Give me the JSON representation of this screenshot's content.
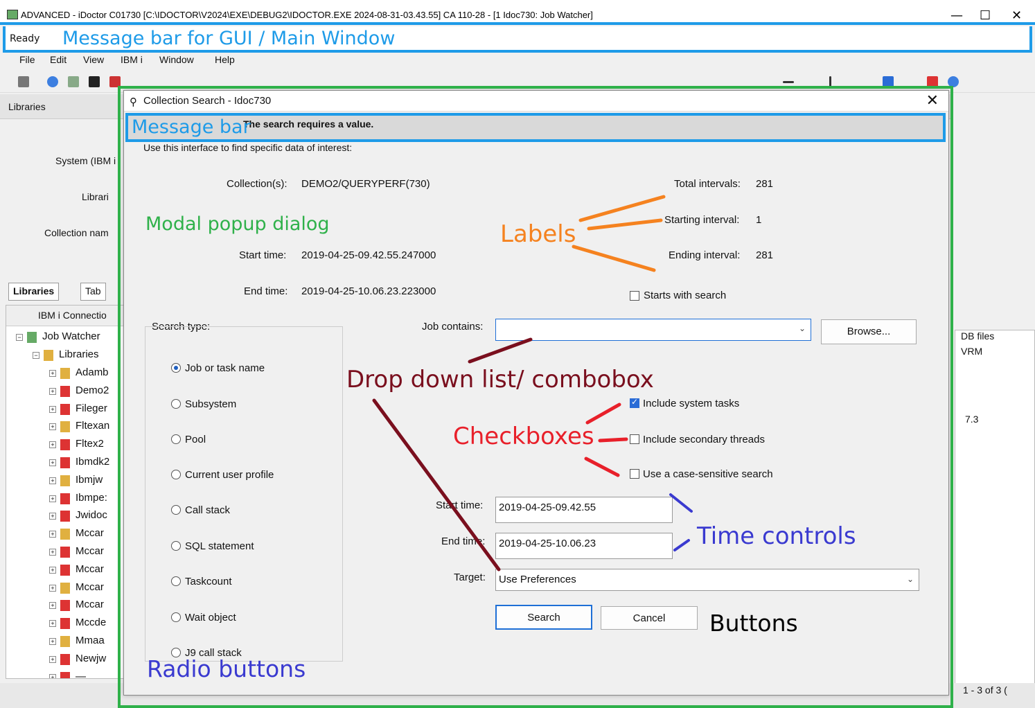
{
  "window": {
    "title": "ADVANCED - iDoctor C01730   [C:\\IDOCTOR\\V2024\\EXE\\DEBUG2\\IDOCTOR.EXE 2024-08-31-03.43.55] CA 110-28 - [1 Idoc730:  Job Watcher]",
    "status": "Ready",
    "minimize": "—",
    "maximize": "☐",
    "close": "✕"
  },
  "menu": [
    "File",
    "Edit",
    "View",
    "IBM i",
    "Window",
    "Help"
  ],
  "background": {
    "libraries_label": "Libraries",
    "system_label": "System (IBM i",
    "library_label": "Librari",
    "collection_label": "Collection nam",
    "tabs": [
      "Libraries",
      "Tab"
    ],
    "tree_header": "IBM i Connectio",
    "tree_root": "Job Watcher",
    "tree_libraries": "Libraries",
    "tree_items": [
      "Adamb",
      "Demo2",
      "Fileger",
      "Fltexan",
      "Fltex2",
      "Ibmdk2",
      "Ibmjw",
      "Ibmpe:",
      "Jwidoc",
      "Mccar",
      "Mccar",
      "Mccar",
      "Mccar",
      "Mccar",
      "Mccde",
      "Mmaa",
      "Newjw",
      "—"
    ],
    "grid_header_1": "DB files",
    "grid_header_2": "VRM",
    "grid_value": "7.3",
    "page_count": "1 - 3 of 3 ("
  },
  "dialog": {
    "title": "Collection Search - Idoc730",
    "close": "✕",
    "message": "The search requires a value.",
    "intro": "Use this interface to find specific data of interest:",
    "collection_label": "Collection(s):",
    "collection_value": "DEMO2/QUERYPERF(730)",
    "start_time_label": "Start time:",
    "start_time_value": "2019-04-25-09.42.55.247000",
    "end_time_label": "End time:",
    "end_time_value": "2019-04-25-10.06.23.223000",
    "total_intervals_label": "Total intervals:",
    "total_intervals_value": "281",
    "starting_interval_label": "Starting interval:",
    "starting_interval_value": "1",
    "ending_interval_label": "Ending interval:",
    "ending_interval_value": "281",
    "starts_with_search": "Starts with search",
    "search_type_label": "Search type:",
    "search_types": [
      "Job or task name",
      "Subsystem",
      "Pool",
      "Current user profile",
      "Call stack",
      "SQL statement",
      "Taskcount",
      "Wait object",
      "J9 call stack"
    ],
    "selected_search_type": "Job or task name",
    "job_contains_label": "Job contains:",
    "job_contains_value": "",
    "browse_button": "Browse...",
    "include_system_tasks": "Include system tasks",
    "include_system_tasks_checked": true,
    "include_secondary_threads": "Include secondary threads",
    "case_sensitive": "Use a case-sensitive search",
    "start_time_field_label": "Start time:",
    "start_time_field_value": "2019-04-25-09.42.55",
    "end_time_field_label": "End time:",
    "end_time_field_value": "2019-04-25-10.06.23",
    "target_label": "Target:",
    "target_value": "Use Preferences",
    "search_button": "Search",
    "cancel_button": "Cancel"
  },
  "annotations": {
    "message_bar_main": "Message bar for GUI / Main Window",
    "message_bar_dialog": "Message bar",
    "modal": "Modal popup dialog",
    "labels": "Labels",
    "dropdown": "Drop down list/ combobox",
    "checkboxes": "Checkboxes",
    "time_controls": "Time controls",
    "buttons": "Buttons",
    "radio_buttons": "Radio buttons"
  },
  "colors": {
    "blue_annotation": "#1e9be8",
    "green_annotation": "#2fb14a",
    "orange_annotation": "#f5821f",
    "darkred_annotation": "#7a0f1e",
    "red_annotation": "#e8202a",
    "navy_annotation": "#3a3ad0"
  }
}
